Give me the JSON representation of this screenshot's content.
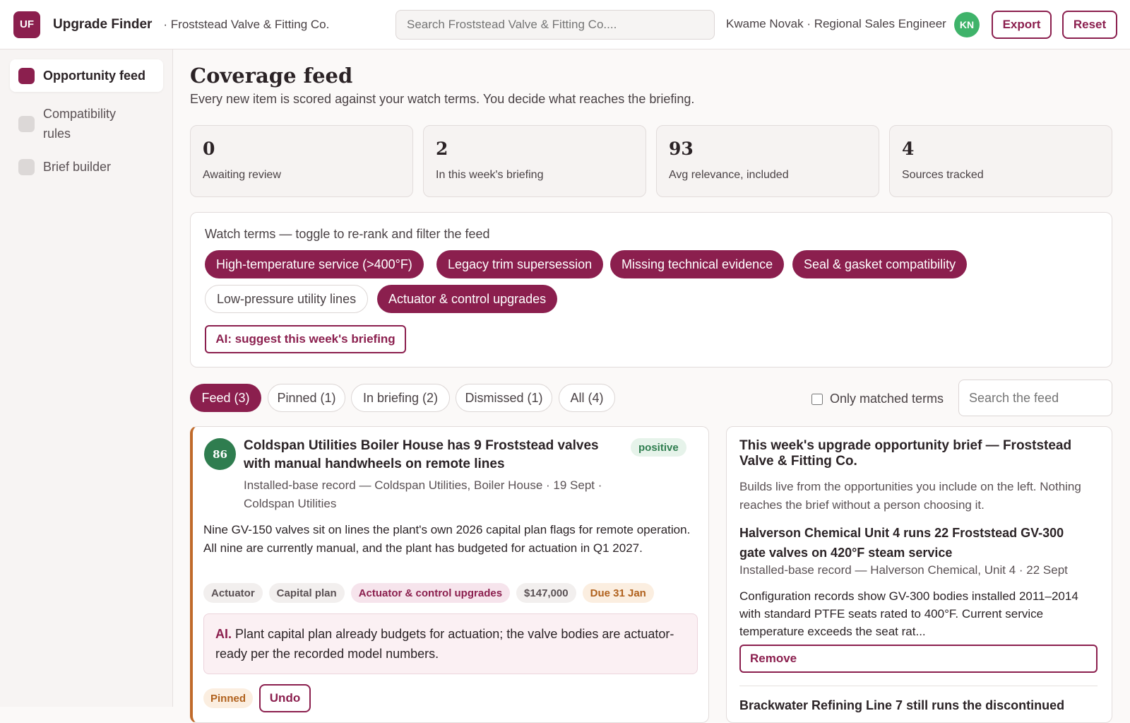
{
  "topbar": {
    "logo": "UF",
    "app_title": "Upgrade Finder",
    "org": "· Froststead Valve & Fitting Co.",
    "search_placeholder": "Search Froststead Valve & Fitting Co....",
    "user": "Kwame Novak · Regional Sales Engineer",
    "avatar": "KN",
    "export_label": "Export",
    "reset_label": "Reset"
  },
  "sidebar": {
    "items": [
      {
        "label": "Opportunity feed",
        "active": true
      },
      {
        "label": "Compatibility rules",
        "active": false
      },
      {
        "label": "Brief builder",
        "active": false
      }
    ]
  },
  "page": {
    "title": "Coverage feed",
    "subtitle": "Every new item is scored against your watch terms. You decide what reaches the briefing."
  },
  "stats": [
    {
      "value": "0",
      "label": "Awaiting review"
    },
    {
      "value": "2",
      "label": "In this week's briefing"
    },
    {
      "value": "93",
      "label": "Avg relevance, included"
    },
    {
      "value": "4",
      "label": "Sources tracked"
    }
  ],
  "watch_terms": {
    "title": "Watch terms — toggle to re-rank and filter the feed",
    "terms": [
      {
        "label": "High-temperature service (>400°F)",
        "on": true
      },
      {
        "label": "Legacy trim supersession",
        "on": true
      },
      {
        "label": "Missing technical evidence",
        "on": true
      },
      {
        "label": "Seal & gasket compatibility",
        "on": true
      },
      {
        "label": "Low-pressure utility lines",
        "on": false
      },
      {
        "label": "Actuator & control upgrades",
        "on": true
      }
    ],
    "ai_button": "AI: suggest this week's briefing"
  },
  "tabs": [
    {
      "label": "Feed (3)",
      "active": true
    },
    {
      "label": "Pinned (1)",
      "active": false
    },
    {
      "label": "In briefing (2)",
      "active": false
    },
    {
      "label": "Dismissed (1)",
      "active": false
    },
    {
      "label": "All (4)",
      "active": false
    }
  ],
  "filters": {
    "only_matched_label": "Only matched terms",
    "only_matched_checked": false,
    "feed_search_placeholder": "Search the feed"
  },
  "feed_card": {
    "score": "86",
    "title": "Coldspan Utilities Boiler House has 9 Froststead valves with manual handwheels on remote lines",
    "sentiment": "positive",
    "meta": "Installed-base record — Coldspan Utilities, Boiler House · 19 Sept · Coldspan Utilities",
    "body": "Nine GV-150 valves sit on lines the plant's own 2026 capital plan flags for remote operation. All nine are currently manual, and the plant has budgeted for actuation in Q1 2027.",
    "tags": [
      "Actuator",
      "Capital plan",
      "Actuator & control upgrades",
      "$147,000",
      "Due 31 Jan"
    ],
    "ai_prefix": "AI.",
    "ai_note": "Plant capital plan already budgets for actuation; the valve bodies are actuator-ready per the recorded model numbers.",
    "status": "Pinned",
    "undo_label": "Undo"
  },
  "brief": {
    "title": "This week's upgrade opportunity brief — Froststead Valve & Fitting Co.",
    "subtitle": "Builds live from the opportunities you include on the left. Nothing reaches the brief without a person choosing it.",
    "items": [
      {
        "title": "Halverson Chemical Unit 4 runs 22 Froststead GV-300 gate valves on 420°F steam service",
        "meta": "Installed-base record — Halverson Chemical, Unit 4 · 22 Sept",
        "body": "Configuration records show GV-300 bodies installed 2011–2014 with standard PTFE seats rated to 400°F. Current service temperature exceeds the seat rat...",
        "remove_label": "Remove"
      },
      {
        "title": "Brackwater Refining Line 7 still runs the discontinued"
      }
    ]
  },
  "colors": {
    "accent": "#8b1f4e",
    "positive": "#2f7d4f",
    "warning": "#b0611d"
  }
}
